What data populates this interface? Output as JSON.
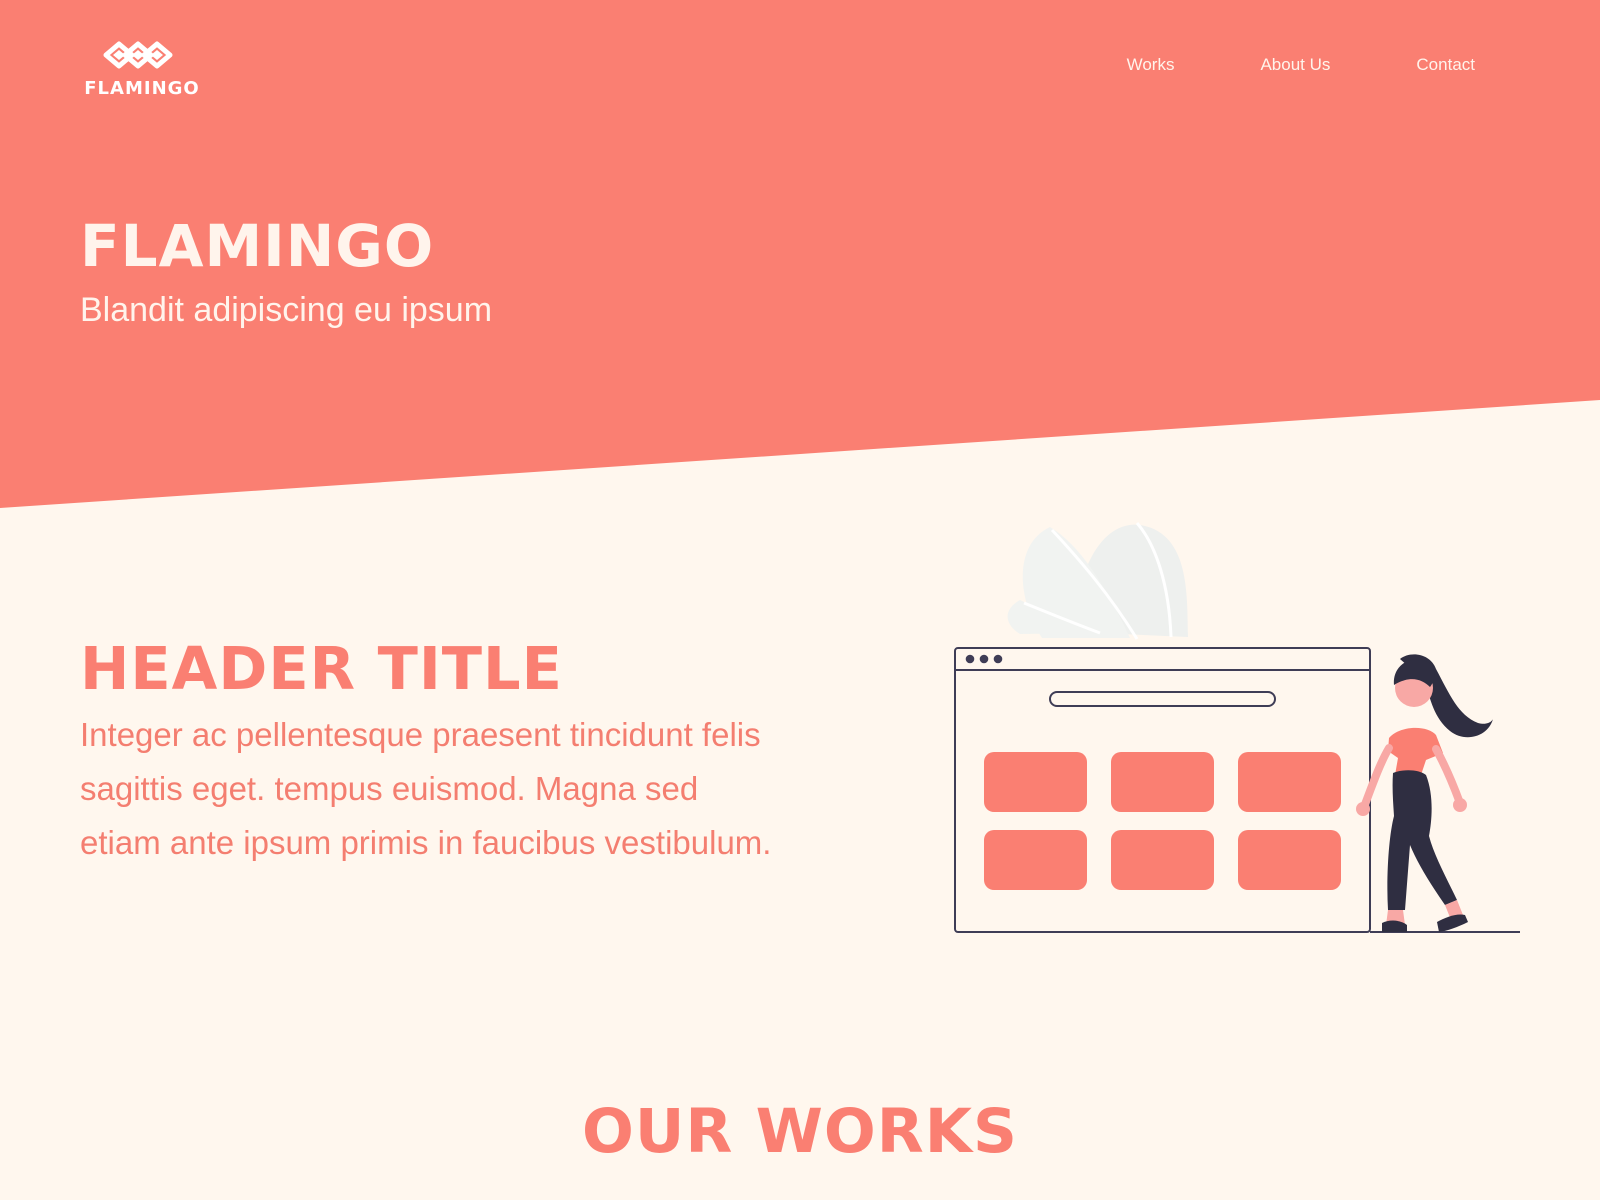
{
  "brand": {
    "logo_text": "FLAMINGO"
  },
  "nav": {
    "items": [
      {
        "label": "Works"
      },
      {
        "label": "About Us"
      },
      {
        "label": "Contact"
      }
    ]
  },
  "hero": {
    "title": "FLAMINGO",
    "subtitle": "Blandit adipiscing eu ipsum"
  },
  "header_section": {
    "title": "HEADER TITLE",
    "body": "Integer ac pellentesque praesent tincidunt felis sagittis eget. tempus euismod. Magna sed etiam ante ipsum primis in faucibus vestibulum."
  },
  "works_section": {
    "title": "OUR WORKS"
  },
  "colors": {
    "accent": "#FA7F72",
    "background": "#FFF7EE",
    "dark": "#2F2E41"
  },
  "icons": {
    "logo": "flamingo-logo-icon",
    "illustration": "browser-window-person-illustration"
  }
}
